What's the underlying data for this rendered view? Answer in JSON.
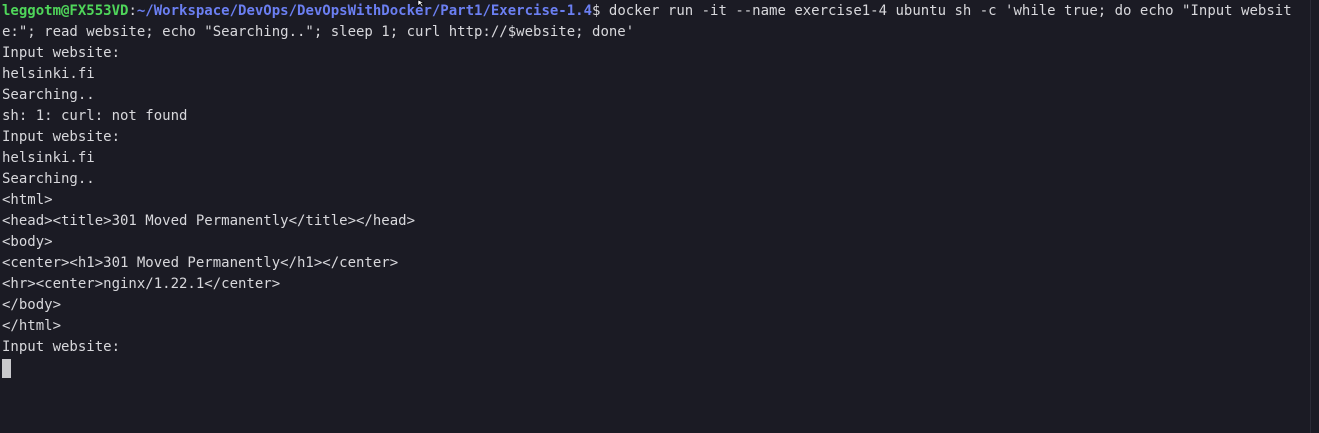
{
  "terminal": {
    "prompt": {
      "user_host": "leggotm@FX553VD",
      "colon": ":",
      "path": "~/Workspace/DevOps/DevOpsWithDocker/Part1/Exercise-1.4",
      "dollar": "$ ",
      "command": "docker run -it --name exercise1-4 ubuntu sh -c 'while true; do echo \"Input website:\"; read website; echo \"Searching..\"; sleep 1; curl http://$website; done'"
    },
    "output_lines": [
      "Input website:",
      "helsinki.fi",
      "Searching..",
      "sh: 1: curl: not found",
      "Input website:",
      "helsinki.fi",
      "Searching..",
      "<html>",
      "<head><title>301 Moved Permanently</title></head>",
      "<body>",
      "<center><h1>301 Moved Permanently</h1></center>",
      "<hr><center>nginx/1.22.1</center>",
      "</body>",
      "</html>",
      "Input website:"
    ]
  },
  "colors": {
    "background": "#1b1b24",
    "text": "#d8d8dc",
    "user_host": "#4fd65a",
    "path": "#6b7ff2"
  }
}
